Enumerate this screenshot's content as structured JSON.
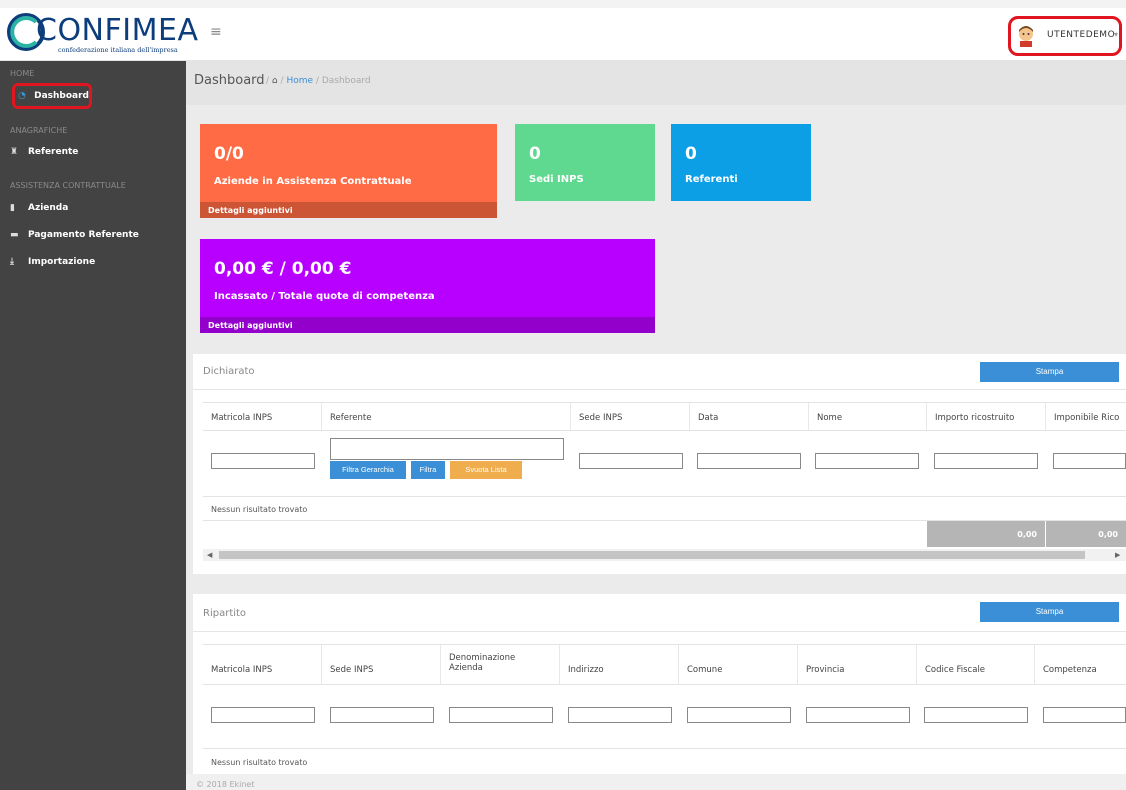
{
  "brand": {
    "name": "CONFIMEA",
    "tagline": "confederazione italiana dell'impresa"
  },
  "header": {
    "menu_icon": "hamburger-icon",
    "username": "UTENTEDEMO",
    "caret": "▾"
  },
  "sidebar": {
    "sections": [
      {
        "label": "HOME"
      },
      {
        "label": "ANAGRAFICHE"
      },
      {
        "label": "ASSISTENZA CONTRATTUALE"
      }
    ],
    "items": [
      {
        "label": "Dashboard",
        "icon": "dashboard-icon",
        "glyph": "◔",
        "active": true
      },
      {
        "label": "Referente",
        "icon": "referente-icon",
        "glyph": "♜"
      },
      {
        "label": "Azienda",
        "icon": "document-icon",
        "glyph": "▮"
      },
      {
        "label": "Pagamento Referente",
        "icon": "credit-card-icon",
        "glyph": "▬"
      },
      {
        "label": "Importazione",
        "icon": "import-icon",
        "glyph": "⤓"
      }
    ]
  },
  "breadcrumb": {
    "title": "Dashboard",
    "separator": "/",
    "home_icon": "home-icon",
    "home": "Home",
    "current": "Dashboard"
  },
  "tiles": [
    {
      "value": "0/0",
      "label": "Aziende in Assistenza Contrattuale",
      "footer": "Dettagli aggiuntivi",
      "color": "#ff6b45",
      "footer_color": "#cc5536"
    },
    {
      "value": "0",
      "label": "Sedi INPS",
      "color": "#5fd98f"
    },
    {
      "value": "0",
      "label": "Referenti",
      "color": "#0d9fe6"
    },
    {
      "value": "0,00 € / 0,00 €",
      "label": "Incassato / Totale quote di competenza",
      "footer": "Dettagli aggiuntivi",
      "color": "#b700ff",
      "footer_color": "#9300cc"
    }
  ],
  "dichiarato": {
    "title": "Dichiarato",
    "print_button": "Stampa",
    "columns": [
      "Matricola INPS",
      "Referente",
      "Sede INPS",
      "Data",
      "Nome",
      "Importo ricostruito",
      "Imponibile Rico"
    ],
    "filter_buttons": [
      {
        "label": "Filtra Gerarchia",
        "color": "#3b8fd6"
      },
      {
        "label": "Filtra",
        "color": "#3b8fd6"
      },
      {
        "label": "Svuota Lista",
        "color": "#f0ad4e"
      }
    ],
    "empty_message": "Nessun risultato trovato",
    "totals": [
      "0,00",
      "0,00"
    ]
  },
  "ripartito": {
    "title": "Ripartito",
    "print_button": "Stampa",
    "columns": [
      "Matricola INPS",
      "Sede INPS",
      "Denominazione Azienda",
      "Indirizzo",
      "Comune",
      "Provincia",
      "Codice Fiscale",
      "Competenza"
    ],
    "empty_message": "Nessun risultato trovato"
  },
  "footer": {
    "text": "© 2018 Ekinet"
  },
  "colors": {
    "sidebar_bg": "#434343",
    "accent": "#3b8fd6",
    "highlight": "#e01520"
  }
}
